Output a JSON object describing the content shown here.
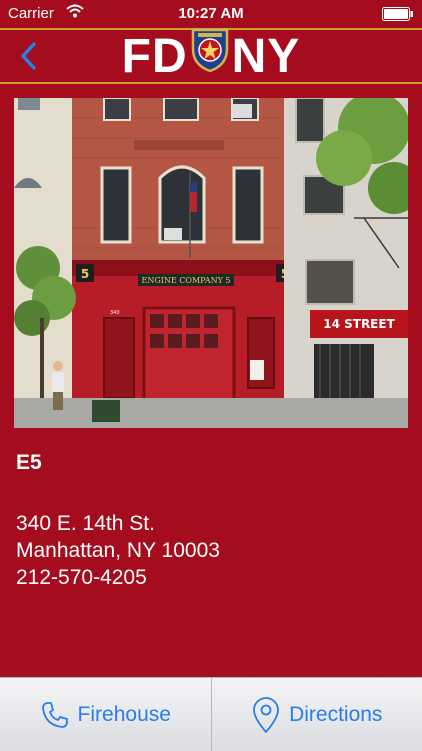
{
  "status_bar": {
    "carrier": "Carrier",
    "time": "10:27 AM"
  },
  "nav": {
    "logo_left": "FD",
    "logo_right": "NY"
  },
  "photo": {
    "signs": {
      "engine": "ENGINE COMPANY 5",
      "number_left": "5",
      "number_right": "5",
      "shop": "14 STREET",
      "address_plate": "340"
    }
  },
  "station": {
    "id": "E5",
    "street": "340 E. 14th St.",
    "city": "Manhattan, NY 10003",
    "phone": "212-570-4205"
  },
  "tabs": [
    {
      "label": "Firehouse",
      "icon": "phone-icon"
    },
    {
      "label": "Directions",
      "icon": "map-pin-icon"
    }
  ],
  "colors": {
    "background": "#a50d1e",
    "gold": "#c9a227",
    "accent": "#2a7ee6"
  }
}
